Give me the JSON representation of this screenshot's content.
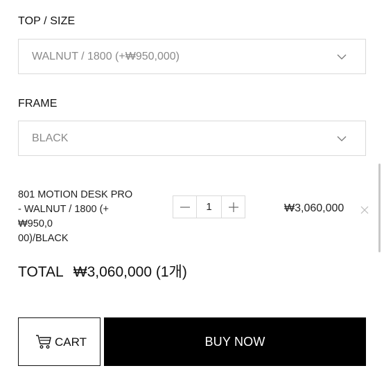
{
  "options": {
    "top_size": {
      "label": "TOP / SIZE",
      "selected": "WALNUT / 1800 (+₩950,000)"
    },
    "frame": {
      "label": "FRAME",
      "selected": "BLACK"
    }
  },
  "selected_item": {
    "name_line1": "801 MOTION DESK PRO",
    "name_line2": "- WALNUT / 1800 (+₩950,0",
    "name_line3": "00)/BLACK",
    "quantity": "1",
    "price": "₩3,060,000"
  },
  "total": {
    "label": "TOTAL",
    "amount": "₩3,060,000 (1개)"
  },
  "actions": {
    "cart_label": "CART",
    "buy_label": "BUY NOW"
  },
  "icons": {
    "dropdown": "chevron-down-icon",
    "minus": "minus-icon",
    "plus": "plus-icon",
    "remove": "close-icon",
    "cart": "cart-icon"
  },
  "colors": {
    "buy_button_bg": "#000000",
    "border": "#d9d9d9",
    "placeholder_text": "#8a8a8a"
  }
}
